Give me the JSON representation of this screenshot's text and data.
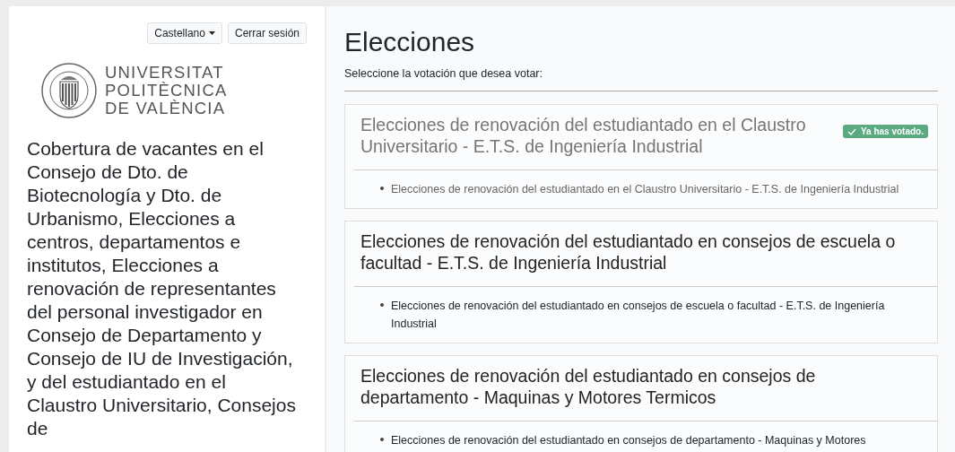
{
  "header": {
    "language_menu": {
      "label": "Castellano"
    },
    "logout_button": {
      "label": "Cerrar sesión"
    }
  },
  "logo": {
    "lines": [
      "UNIVERSITAT",
      "POLITÈCNICA",
      "DE VALÈNCIA"
    ]
  },
  "sidebar": {
    "title": "Cobertura de vacantes en el Consejo de Dto. de Biotecnología y Dto. de Urbanismo, Elecciones a centros, departamentos e institutos, Elecciones a renovación de representantes del personal investigador en Consejo de Departamento y Consejo de IU de Investigación, y del estudiantado en el Claustro Universitario, Consejos de"
  },
  "main": {
    "title": "Elecciones",
    "instruction": "Seleccione la votación que desea votar:",
    "elections": [
      {
        "title": "Elecciones de renovación del estudiantado en el Claustro Universitario - E.T.S. de Ingeniería Industrial",
        "voted": true,
        "badge": "Ya has votado.",
        "items": [
          "Elecciones de renovación del estudiantado en el Claustro Universitario - E.T.S. de Ingeniería Industrial"
        ]
      },
      {
        "title": "Elecciones de renovación del estudiantado en consejos de escuela o facultad - E.T.S. de Ingeniería Industrial",
        "voted": false,
        "items": [
          "Elecciones de renovación del estudiantado en consejos de escuela o facultad - E.T.S. de Ingeniería Industrial"
        ]
      },
      {
        "title": "Elecciones de renovación del estudiantado en consejos de departamento - Maquinas y Motores Termicos",
        "voted": false,
        "items": [
          "Elecciones de renovación del estudiantado en consejos de departamento - Maquinas y Motores"
        ]
      }
    ]
  }
}
